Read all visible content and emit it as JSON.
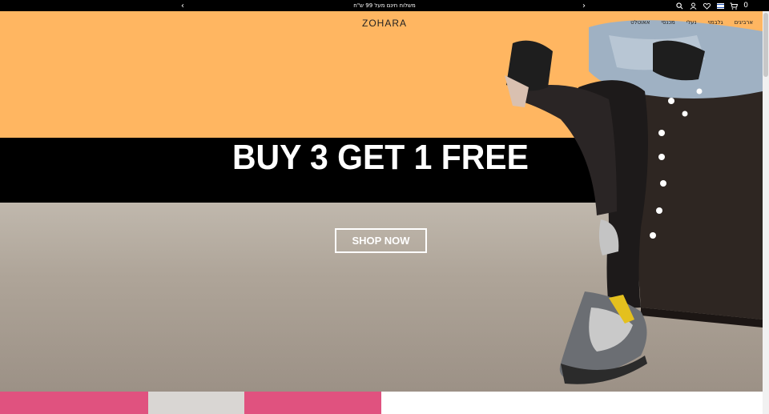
{
  "announcement": {
    "text": "משלוח חינם מעל 99 ש\"ח",
    "prev": "‹",
    "next": "›"
  },
  "header": {
    "logo": "ZOHARA",
    "nav": [
      "ארביגים",
      "גלבמוי",
      "נעלי",
      "מכנסי",
      "אאוטלט"
    ],
    "cart_count": "0"
  },
  "hero": {
    "headline": "BUY 3 GET 1 FREE",
    "cta": "SHOP NOW"
  },
  "colors": {
    "sky": "#ffb661",
    "band": "#000000",
    "accent_pink": "#e0527f"
  }
}
